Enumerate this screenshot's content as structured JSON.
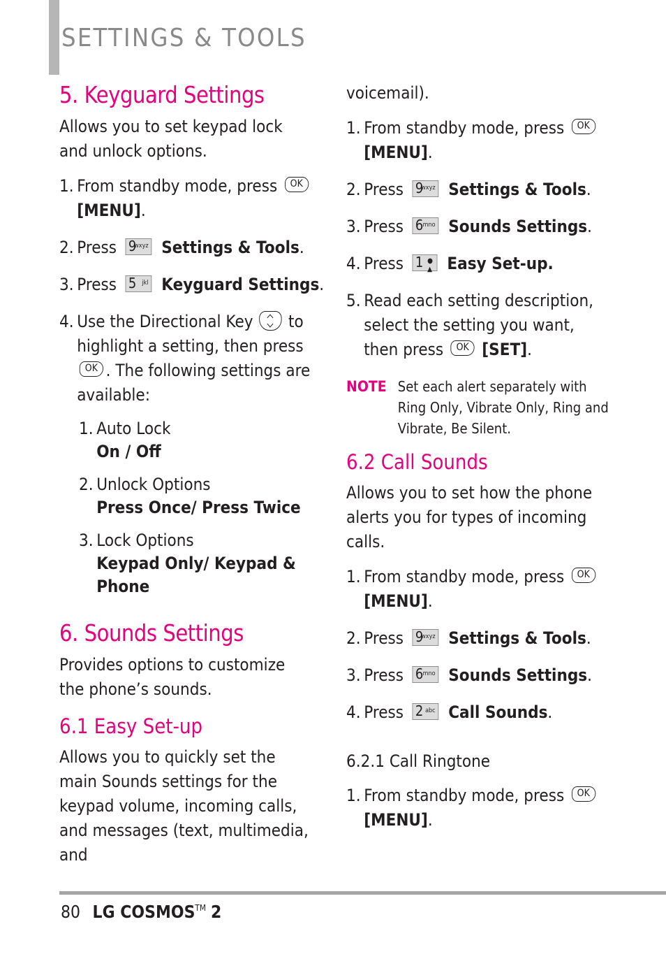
{
  "header": {
    "title": "SETTINGS & TOOLS"
  },
  "colors": {
    "accent": "#e5007e",
    "header_gray": "#8a898a",
    "bar_gray": "#b7b6b7"
  },
  "keys": {
    "ok": "OK",
    "k9": {
      "num": "9",
      "letters": "wxyz"
    },
    "k5": {
      "num": "5",
      "letters": "jkl"
    },
    "k6": {
      "num": "6",
      "letters": "mno"
    },
    "k2": {
      "num": "2",
      "letters": "abc"
    },
    "k1": {
      "num": "1",
      "letters": "voicemail-icon"
    }
  },
  "keyguard": {
    "heading": "5. Keyguard Settings",
    "intro": "Allows you to set keypad lock and unlock options.",
    "steps": [
      {
        "num": "1.",
        "pre": "From standby mode, press",
        "bold": "[MENU]",
        "post": "."
      },
      {
        "num": "2.",
        "pre": "Press",
        "bold": "Settings & Tools",
        "post": "."
      },
      {
        "num": "3.",
        "pre": "Press",
        "bold": "Keyguard Settings",
        "post": "."
      },
      {
        "num": "4.",
        "pre": "Use the Directional Key",
        "mid": "to highlight a setting, then press",
        "post": ". The following settings are available:"
      }
    ],
    "options": [
      {
        "num": "1.",
        "name": "Auto Lock",
        "values": "On / Off"
      },
      {
        "num": "2.",
        "name": "Unlock Options",
        "values": "Press Once/ Press Twice"
      },
      {
        "num": "3.",
        "name": "Lock Options",
        "values": "Keypad Only/ Keypad & Phone"
      }
    ]
  },
  "sounds": {
    "heading": "6. Sounds Settings",
    "intro": "Provides options to customize the phone’s sounds."
  },
  "easy_setup": {
    "heading": "6.1 Easy Set-up",
    "intro": "Allows you to quickly set the main Sounds settings for the keypad volume, incoming calls, and messages (text, multimedia, and",
    "intro_cont": "voicemail).",
    "steps": [
      {
        "num": "1.",
        "pre": "From standby mode, press",
        "bold": "[MENU]",
        "post": "."
      },
      {
        "num": "2.",
        "pre": "Press",
        "bold": "Settings & Tools",
        "post": "."
      },
      {
        "num": "3.",
        "pre": "Press",
        "bold": "Sounds Settings",
        "post": "."
      },
      {
        "num": "4.",
        "pre": "Press",
        "bold": "Easy Set-up.",
        "post": ""
      },
      {
        "num": "5.",
        "pre": "Read each setting description, select the setting you want, then press",
        "bold": "[SET]",
        "post": "."
      }
    ],
    "note_label": "NOTE",
    "note_text": "Set each alert separately with Ring Only, Vibrate Only, Ring and Vibrate, Be Silent."
  },
  "call_sounds": {
    "heading": "6.2 Call Sounds",
    "intro": "Allows you to set how the phone alerts you for types of incoming calls.",
    "steps": [
      {
        "num": "1.",
        "pre": "From standby mode, press",
        "bold": "[MENU]",
        "post": "."
      },
      {
        "num": "2.",
        "pre": "Press",
        "bold": "Settings & Tools",
        "post": "."
      },
      {
        "num": "3.",
        "pre": "Press",
        "bold": "Sounds Settings",
        "post": "."
      },
      {
        "num": "4.",
        "pre": "Press",
        "bold": "Call Sounds",
        "post": "."
      }
    ]
  },
  "call_ringtone": {
    "heading": "6.2.1 Call Ringtone",
    "steps": [
      {
        "num": "1.",
        "pre": "From standby mode, press",
        "bold": "[MENU]",
        "post": "."
      }
    ]
  },
  "footer": {
    "page_number": "80",
    "brand": "LG COSMOS",
    "trademark": "TM",
    "model": "2"
  }
}
